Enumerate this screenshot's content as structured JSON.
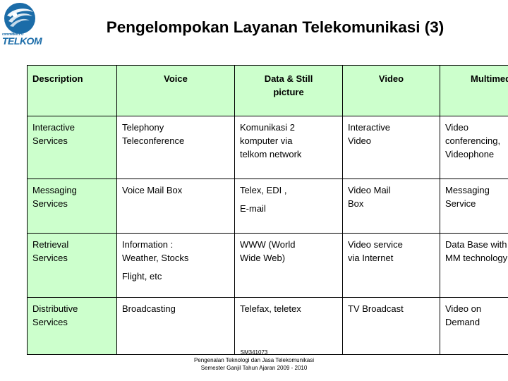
{
  "logo": {
    "name": "telkom-logo",
    "wordmark": "TELKOM",
    "tagline": "committed 2 U",
    "circle_color": "#1B6CA8",
    "swoosh_color": "#FFFFFF"
  },
  "title": "Pengelompokan Layanan Telekomunikasi (3)",
  "table": {
    "header_bg": "#CCFFCC",
    "border_color": "#000000",
    "headers": [
      "Description",
      "Voice",
      "Data & Still picture",
      "Video",
      "Multimedia"
    ],
    "header_lines": [
      [
        "Description"
      ],
      [
        "Voice"
      ],
      [
        "Data & Still",
        "picture"
      ],
      [
        "Video"
      ],
      [
        "Multimedia"
      ]
    ],
    "rows": [
      {
        "category": [
          "Interactive",
          "Services"
        ],
        "voice": [
          "Telephony",
          "Teleconference"
        ],
        "data_still_picture": [
          "Komunikasi 2",
          "komputer via",
          "telkom network"
        ],
        "video": [
          "Interactive",
          "Video"
        ],
        "multimedia": [
          "Video",
          "conferencing,",
          "Videophone"
        ]
      },
      {
        "category": [
          "Messaging",
          "Services"
        ],
        "voice": [
          "Voice Mail  Box"
        ],
        "data_still_picture": [
          "Telex, EDI ,",
          "E-mail"
        ],
        "video": [
          "Video Mail",
          "Box"
        ],
        "multimedia": [
          "Messaging",
          "Service"
        ]
      },
      {
        "category": [
          "Retrieval",
          "Services"
        ],
        "voice": [
          "Information :",
          "Weather, Stocks",
          "Flight, etc"
        ],
        "data_still_picture": [
          "WWW (World",
          "Wide Web)"
        ],
        "video": [
          "Video service",
          "via Internet"
        ],
        "multimedia": [
          "Data Base with",
          "MM technology"
        ]
      },
      {
        "category": [
          "Distributive",
          "Services"
        ],
        "voice": [
          "Broadcasting"
        ],
        "data_still_picture": [
          "Telefax, teletex"
        ],
        "video": [
          "TV Broadcast"
        ],
        "multimedia": [
          "Video on",
          "Demand"
        ]
      }
    ]
  },
  "footer": {
    "course_code": "SM341073",
    "course_name": "Pengenalan Teknologi dan Jasa Telekomunikasi",
    "semester": "Semester Ganjil Tahun Ajaran 2009 - 2010"
  }
}
